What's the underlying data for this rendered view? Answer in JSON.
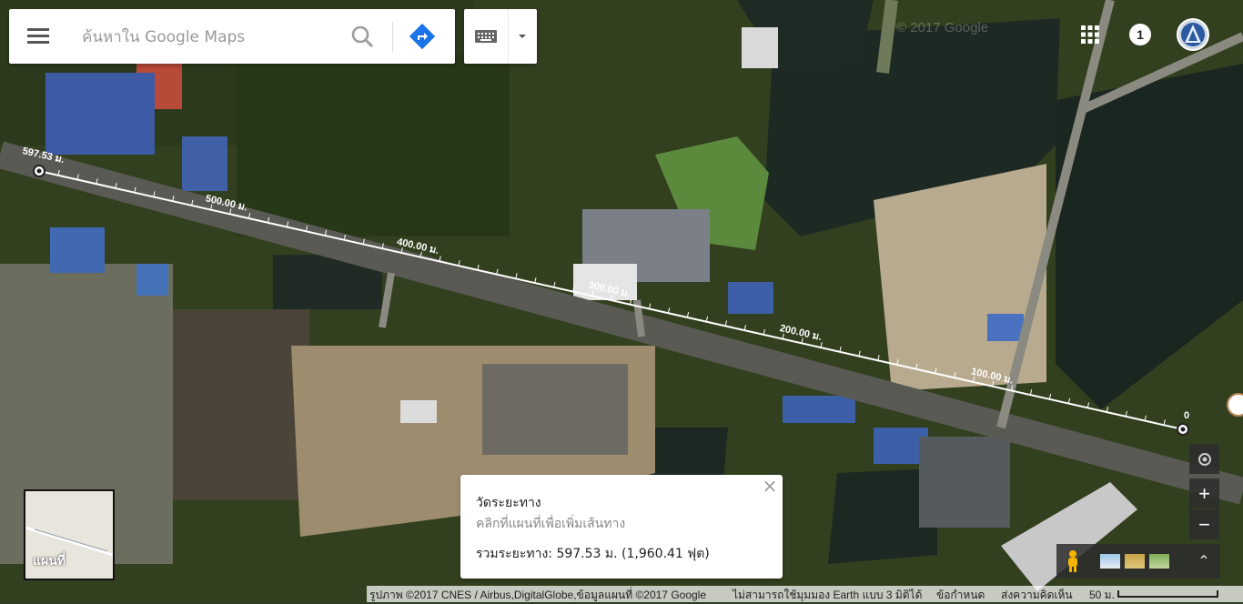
{
  "search": {
    "placeholder": "ค้นหาใน Google Maps"
  },
  "header": {
    "notification_count": "1"
  },
  "watermark": "© 2017 Google",
  "measure": {
    "title": "วัดระยะทาง",
    "hint": "คลิกที่แผนที่เพื่อเพิ่มเส้นทาง",
    "total": "รวมระยะทาง: 597.53 ม. (1,960.41 ฟุต)",
    "close": "×",
    "start_label": "597.53 ม.",
    "end_label": "0",
    "tick_labels": [
      "500.00 ม.",
      "400.00 ม.",
      "300.00 ม.",
      "200.00 ม.",
      "100.00 ม."
    ]
  },
  "minimap": {
    "label": "แผนที่"
  },
  "zoom": {
    "in": "+",
    "out": "−"
  },
  "footer": {
    "imagery": "รูปภาพ ©2017 CNES / Airbus,DigitalGlobe,ข้อมูลแผนที่ ©2017 Google",
    "earth": "ไม่สามารถใช้มุมมอง Earth แบบ 3 มิติได้",
    "terms": "ข้อกำหนด",
    "feedback": "ส่งความคิดเห็น",
    "scale": "50 ม."
  },
  "icons": {
    "menu": "menu-icon",
    "search": "search-icon",
    "directions": "directions-icon",
    "keyboard": "keyboard-icon",
    "apps": "apps-grid-icon",
    "avatar": "avatar-icon",
    "pegman": "pegman-icon",
    "locate": "my-location-icon"
  }
}
